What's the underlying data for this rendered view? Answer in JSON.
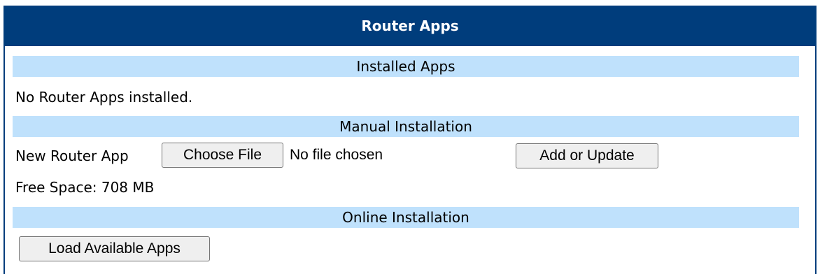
{
  "panel": {
    "title": "Router Apps"
  },
  "installed": {
    "heading": "Installed Apps",
    "status_text": "No Router Apps installed."
  },
  "manual": {
    "heading": "Manual Installation",
    "field_label": "New Router App",
    "choose_file_label": "Choose File",
    "file_status": "No file chosen",
    "add_update_label": "Add or Update",
    "free_space": "Free Space: 708 MB"
  },
  "online": {
    "heading": "Online Installation",
    "load_button_label": "Load Available Apps"
  },
  "colors": {
    "header_bg": "#003d7c",
    "section_bg": "#bfe1fc",
    "button_bg": "#efefef"
  }
}
